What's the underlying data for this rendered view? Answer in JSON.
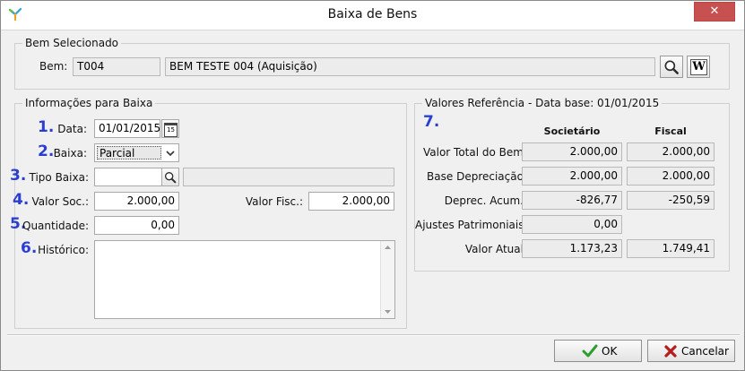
{
  "window": {
    "title": "Baixa de Bens",
    "close_label": "✕"
  },
  "bem_group": {
    "title": "Bem Selecionado",
    "label": "Bem:",
    "code": "T004",
    "description": "BEM TESTE 004 (Aquisição)",
    "wiki_label": "W"
  },
  "info_group": {
    "title": "Informações para Baixa",
    "step_numbers": [
      "1.",
      "2.",
      "3.",
      "4.",
      "5.",
      "6."
    ],
    "data_label": "Data:",
    "data_value": "01/01/2015",
    "calendar_label": "15",
    "baixa_label": "Baixa:",
    "baixa_value": "Parcial",
    "tipo_label": "Tipo Baixa:",
    "tipo_value": "",
    "tipo_desc": "",
    "valor_soc_label": "Valor Soc.:",
    "valor_soc_value": "2.000,00",
    "valor_fisc_label": "Valor Fisc.:",
    "valor_fisc_value": "2.000,00",
    "quantidade_label": "Quantidade:",
    "quantidade_value": "0,00",
    "historico_label": "Histórico:",
    "historico_value": ""
  },
  "ref_group": {
    "title": "Valores Referência - Data base: 01/01/2015",
    "step_number": "7.",
    "col_societario": "Societário",
    "col_fiscal": "Fiscal",
    "rows": [
      {
        "label": "Valor Total do Bem:",
        "soc": "2.000,00",
        "fisc": "2.000,00"
      },
      {
        "label": "Base Depreciação:",
        "soc": "2.000,00",
        "fisc": "2.000,00"
      },
      {
        "label": "Deprec. Acum.:",
        "soc": "-826,77",
        "fisc": "-250,59"
      },
      {
        "label": "Ajustes Patrimoniais:",
        "soc": "0,00",
        "fisc": null
      },
      {
        "label": "Valor Atual:",
        "soc": "1.173,23",
        "fisc": "1.749,41"
      }
    ]
  },
  "actions": {
    "ok_label": "OK",
    "cancel_label": "Cancelar"
  },
  "colors": {
    "step_number": "#2a3fcf",
    "close_button": "#c75050",
    "ok_check": "#2e9e2e",
    "cancel_x": "#b51c1c"
  },
  "icons": [
    "app-logo",
    "close-icon",
    "search-icon",
    "wiki-icon",
    "calendar-icon",
    "chevron-down-icon",
    "ok-check-icon",
    "cancel-x-icon"
  ]
}
